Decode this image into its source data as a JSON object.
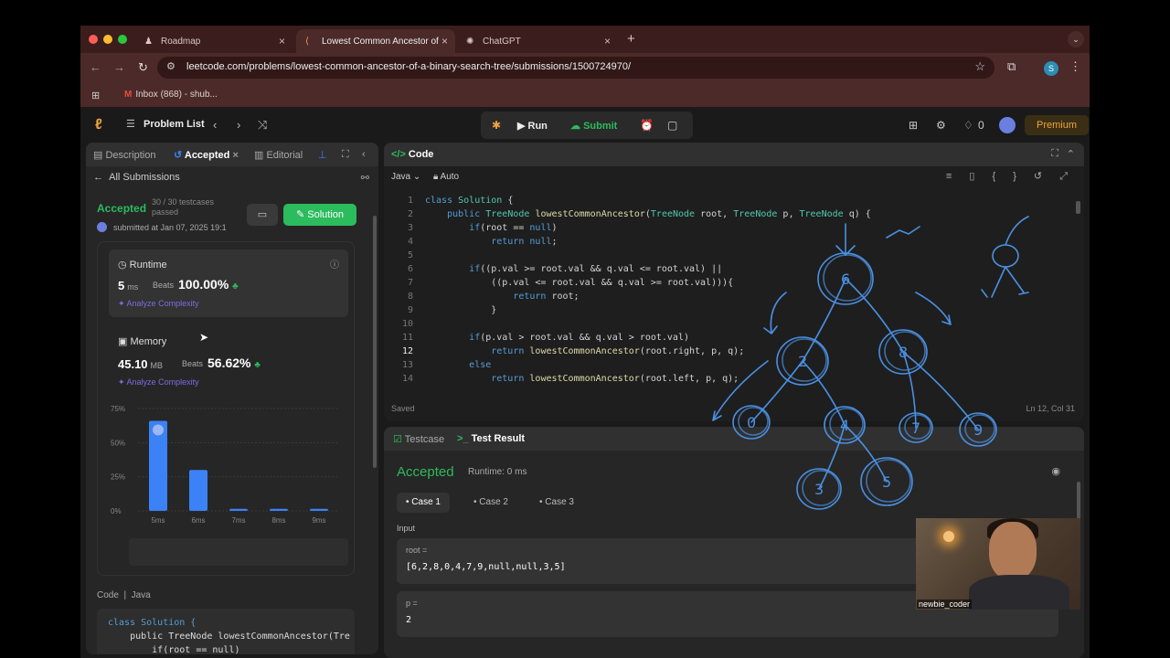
{
  "browser": {
    "tabs": [
      {
        "label": "Roadmap",
        "icon": "roadmap-icon"
      },
      {
        "label": "Lowest Common Ancestor of",
        "icon": "leetcode-icon"
      },
      {
        "label": "ChatGPT",
        "icon": "chatgpt-icon"
      }
    ],
    "url": "leetcode.com/problems/lowest-common-ancestor-of-a-binary-search-tree/submissions/1500724970/",
    "bookmark": "Inbox (868) - shub...",
    "profile_initial": "S"
  },
  "lc_nav": {
    "problem_list": "Problem List",
    "run": "Run",
    "submit": "Submit",
    "streak": "0",
    "premium": "Premium"
  },
  "left": {
    "tabs": [
      "Description",
      "Accepted",
      "Editorial"
    ],
    "all_submissions": "All Submissions",
    "status": "Accepted",
    "testcases": "30 / 30 testcases passed",
    "submitted": "submitted at Jan 07, 2025 19:1",
    "solution_btn": "Solution",
    "runtime": {
      "title": "Runtime",
      "value": "5",
      "unit": "ms",
      "beats": "Beats",
      "percent": "100.00%",
      "analyze": "Analyze Complexity"
    },
    "memory": {
      "title": "Memory",
      "value": "45.10",
      "unit": "MB",
      "beats": "Beats",
      "percent": "56.62%",
      "analyze": "Analyze Complexity"
    },
    "code_label": "Code",
    "code_lang": "Java",
    "code_preview": [
      "class Solution {",
      "    public TreeNode lowestCommonAncestor(Tre",
      "        if(root == null)"
    ]
  },
  "chart_data": {
    "type": "bar",
    "categories": [
      "5ms",
      "6ms",
      "7ms",
      "8ms",
      "9ms"
    ],
    "values": [
      66,
      30,
      1.5,
      1.5,
      1.5
    ],
    "ylim": [
      0,
      75
    ],
    "yticks": [
      "75%",
      "50%",
      "25%",
      "0%"
    ],
    "highlight": "5ms",
    "color": "#3b82f6"
  },
  "editor": {
    "title": "Code",
    "language": "Java",
    "mode": "Auto",
    "saved": "Saved",
    "position": "Ln 12, Col 31",
    "lines": [
      {
        "n": "1",
        "text": "class Solution {"
      },
      {
        "n": "2",
        "text": "    public TreeNode lowestCommonAncestor(TreeNode root, TreeNode p, TreeNode q) {"
      },
      {
        "n": "3",
        "text": "        if(root == null)"
      },
      {
        "n": "4",
        "text": "            return null;"
      },
      {
        "n": "5",
        "text": ""
      },
      {
        "n": "6",
        "text": "        if((p.val >= root.val && q.val <= root.val) ||"
      },
      {
        "n": "7",
        "text": "            ((p.val <= root.val && q.val >= root.val))){"
      },
      {
        "n": "8",
        "text": "                return root;"
      },
      {
        "n": "9",
        "text": "            }"
      },
      {
        "n": "10",
        "text": ""
      },
      {
        "n": "11",
        "text": "        if(p.val > root.val && q.val > root.val)"
      },
      {
        "n": "12",
        "text": "            return lowestCommonAncestor(root.right, p, q);"
      },
      {
        "n": "13",
        "text": "        else"
      },
      {
        "n": "14",
        "text": "            return lowestCommonAncestor(root.left, p, q);"
      }
    ]
  },
  "testpanel": {
    "tabs": [
      "Testcase",
      "Test Result"
    ],
    "status": "Accepted",
    "runtime": "Runtime: 0 ms",
    "cases": [
      "Case 1",
      "Case 2",
      "Case 3"
    ],
    "input_label": "Input",
    "fields": [
      {
        "key": "root =",
        "value": "[6,2,8,0,4,7,9,null,null,3,5]"
      },
      {
        "key": "p =",
        "value": "2"
      }
    ]
  },
  "drawing": {
    "color": "#4a90e2",
    "nodes": [
      "6",
      "2",
      "8",
      "0",
      "4",
      "7",
      "9",
      "3",
      "5"
    ]
  },
  "webcam": {
    "name": "newbie_coder"
  }
}
